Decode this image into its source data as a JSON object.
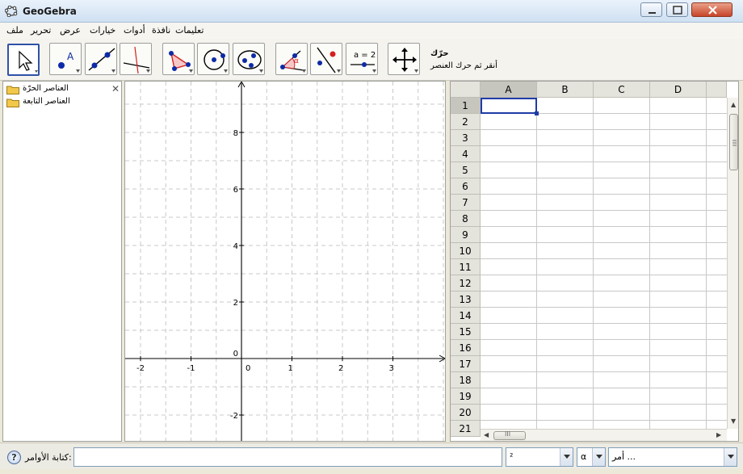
{
  "window": {
    "title": "GeoGebra"
  },
  "menu": [
    "ملف",
    "تحرير",
    "عرض",
    "خيارات",
    "أدوات",
    "نافذة",
    "تعليمات"
  ],
  "toolbar": {
    "active_tool_name": "حرّك",
    "active_tool_help": "أنقر ثم حرك العنصر",
    "slider_tool_label": "a = 2",
    "point_tool_label": "A"
  },
  "algebra": {
    "items": [
      "العناصر الحرّة",
      "العناصر التابعة"
    ],
    "close_symbol": "✕"
  },
  "graphics": {
    "x_ticks": [
      "-2",
      "-1",
      "0",
      "1",
      "2",
      "3"
    ],
    "y_ticks": [
      "8",
      "6",
      "4",
      "2",
      "0",
      "-2"
    ]
  },
  "spreadsheet": {
    "columns": [
      "A",
      "B",
      "C",
      "D"
    ],
    "rows": [
      "1",
      "2",
      "3",
      "4",
      "5",
      "6",
      "7",
      "8",
      "9",
      "10",
      "11",
      "12",
      "13",
      "14",
      "15",
      "16",
      "17",
      "18",
      "19",
      "20",
      "21"
    ],
    "selected_cell": "A1",
    "hscroll_grip": "III"
  },
  "inputbar": {
    "label": "كتابة الأوامر:",
    "help_symbol": "?",
    "symbol_combo_value": "²",
    "greek_combo_value": "α",
    "command_combo_value": "أمر ..."
  },
  "colors": {
    "selection": "#1f3ca6",
    "point": "#0d2aa6",
    "point_red": "#d62020",
    "folder": "#f2c84b"
  }
}
